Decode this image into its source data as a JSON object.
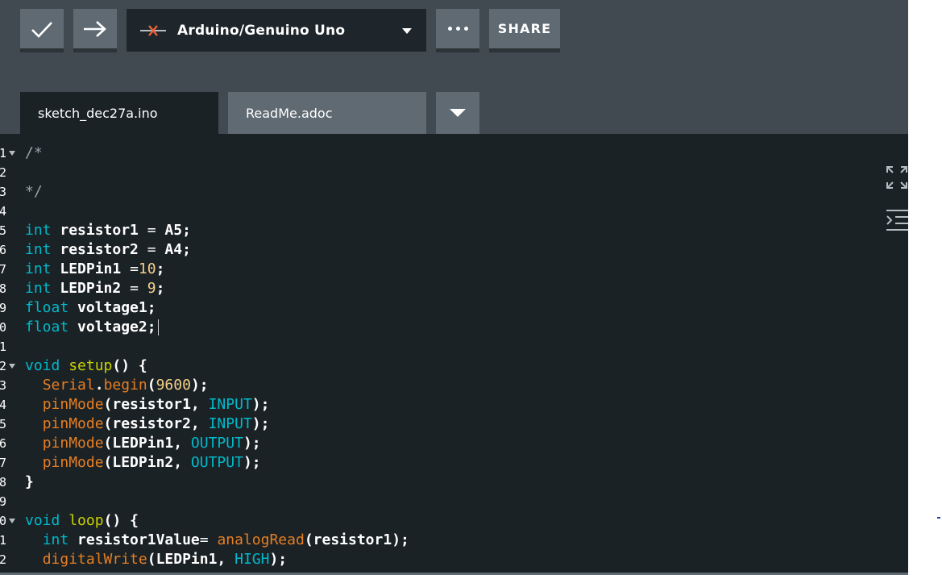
{
  "toolbar": {
    "verify_icon": "checkmark-icon",
    "upload_icon": "arrow-right-icon",
    "board_icon": "board-connection-icon",
    "board_name": "Arduino/Genuino Uno",
    "more_icon": "ellipsis-icon",
    "share_label": "SHARE"
  },
  "tabs": [
    {
      "label": "sketch_dec27a.ino",
      "active": true
    },
    {
      "label": "ReadMe.adoc",
      "active": false
    }
  ],
  "editor": {
    "line_numbers": [
      "1",
      "2",
      "3",
      "4",
      "5",
      "6",
      "7",
      "8",
      "9",
      "0",
      "1",
      "2",
      "3",
      "4",
      "5",
      "6",
      "7",
      "8",
      "9",
      "0",
      "1",
      "2"
    ],
    "lines": [
      [
        {
          "t": "/*",
          "c": "comment"
        }
      ],
      [],
      [
        {
          "t": "*/",
          "c": "comment"
        }
      ],
      [],
      [
        {
          "t": "int",
          "c": "type"
        },
        {
          "t": " resistor1 ",
          "c": "plain"
        },
        {
          "t": "=",
          "c": "op"
        },
        {
          "t": " A5;",
          "c": "plain"
        }
      ],
      [
        {
          "t": "int",
          "c": "type"
        },
        {
          "t": " resistor2 ",
          "c": "plain"
        },
        {
          "t": "=",
          "c": "op"
        },
        {
          "t": " A4;",
          "c": "plain"
        }
      ],
      [
        {
          "t": "int",
          "c": "type"
        },
        {
          "t": " LEDPin1 ",
          "c": "plain"
        },
        {
          "t": "=",
          "c": "op"
        },
        {
          "t": "10",
          "c": "num"
        },
        {
          "t": ";",
          "c": "plain"
        }
      ],
      [
        {
          "t": "int",
          "c": "type"
        },
        {
          "t": " LEDPin2 ",
          "c": "plain"
        },
        {
          "t": "=",
          "c": "op"
        },
        {
          "t": " ",
          "c": "plain"
        },
        {
          "t": "9",
          "c": "num"
        },
        {
          "t": ";",
          "c": "plain"
        }
      ],
      [
        {
          "t": "float",
          "c": "type"
        },
        {
          "t": " voltage1;",
          "c": "plain"
        }
      ],
      [
        {
          "t": "float",
          "c": "type"
        },
        {
          "t": " voltage2;",
          "c": "plain"
        }
      ],
      [],
      [
        {
          "t": "void",
          "c": "type"
        },
        {
          "t": " ",
          "c": "plain"
        },
        {
          "t": "setup",
          "c": "vfunc"
        },
        {
          "t": "() {",
          "c": "plain"
        }
      ],
      [
        {
          "t": "  ",
          "c": "plain"
        },
        {
          "t": "Serial",
          "c": "func"
        },
        {
          "t": ".",
          "c": "plain"
        },
        {
          "t": "begin",
          "c": "func"
        },
        {
          "t": "(",
          "c": "plain"
        },
        {
          "t": "9600",
          "c": "num"
        },
        {
          "t": ");",
          "c": "plain"
        }
      ],
      [
        {
          "t": "  ",
          "c": "plain"
        },
        {
          "t": "pinMode",
          "c": "func"
        },
        {
          "t": "(resistor1, ",
          "c": "plain"
        },
        {
          "t": "INPUT",
          "c": "const"
        },
        {
          "t": ");",
          "c": "plain"
        }
      ],
      [
        {
          "t": "  ",
          "c": "plain"
        },
        {
          "t": "pinMode",
          "c": "func"
        },
        {
          "t": "(resistor2, ",
          "c": "plain"
        },
        {
          "t": "INPUT",
          "c": "const"
        },
        {
          "t": ");",
          "c": "plain"
        }
      ],
      [
        {
          "t": "  ",
          "c": "plain"
        },
        {
          "t": "pinMode",
          "c": "func"
        },
        {
          "t": "(LEDPin1, ",
          "c": "plain"
        },
        {
          "t": "OUTPUT",
          "c": "const"
        },
        {
          "t": ");",
          "c": "plain"
        }
      ],
      [
        {
          "t": "  ",
          "c": "plain"
        },
        {
          "t": "pinMode",
          "c": "func"
        },
        {
          "t": "(LEDPin2, ",
          "c": "plain"
        },
        {
          "t": "OUTPUT",
          "c": "const"
        },
        {
          "t": ");",
          "c": "plain"
        }
      ],
      [
        {
          "t": "}",
          "c": "plain"
        }
      ],
      [],
      [
        {
          "t": "void",
          "c": "type"
        },
        {
          "t": " ",
          "c": "plain"
        },
        {
          "t": "loop",
          "c": "vfunc"
        },
        {
          "t": "() {",
          "c": "plain"
        }
      ],
      [
        {
          "t": "  ",
          "c": "plain"
        },
        {
          "t": "int",
          "c": "type"
        },
        {
          "t": " resistor1Value",
          "c": "plain"
        },
        {
          "t": "=",
          "c": "op"
        },
        {
          "t": " ",
          "c": "plain"
        },
        {
          "t": "analogRead",
          "c": "func"
        },
        {
          "t": "(resistor1);",
          "c": "plain"
        }
      ],
      [
        {
          "t": "  ",
          "c": "plain"
        },
        {
          "t": "digitalWrite",
          "c": "func"
        },
        {
          "t": "(LEDPin1, ",
          "c": "plain"
        },
        {
          "t": "HIGH",
          "c": "const"
        },
        {
          "t": ");",
          "c": "plain"
        }
      ]
    ],
    "fold_lines": [
      0,
      11,
      19
    ],
    "cursor_line": 9
  },
  "side_icons": [
    "expand-icon",
    "outdent-icon"
  ],
  "colors": {
    "toolbar_bg": "#414a50",
    "button_bg": "#5f6a72",
    "editor_bg": "#1b2226",
    "keyword": "#00b9cb",
    "function": "#e67e22",
    "number": "#f5d08a",
    "decl_function": "#c9d200"
  }
}
